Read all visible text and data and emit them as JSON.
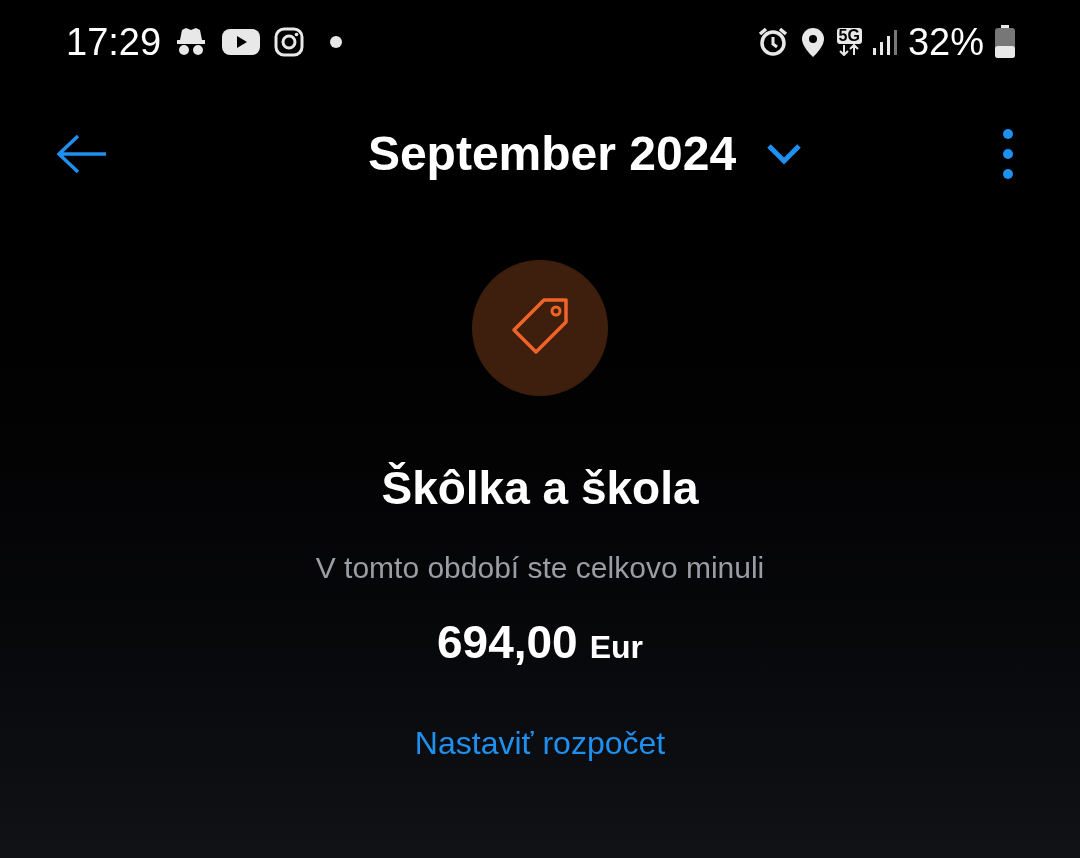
{
  "status_bar": {
    "time": "17:29",
    "network": "5G",
    "battery": "32%"
  },
  "header": {
    "title": "September 2024"
  },
  "category": {
    "name": "Škôlka a škola",
    "subtitle": "V tomto období ste celkovo minuli",
    "amount": "694,00",
    "currency": "Eur",
    "link": "Nastaviť rozpočet"
  }
}
